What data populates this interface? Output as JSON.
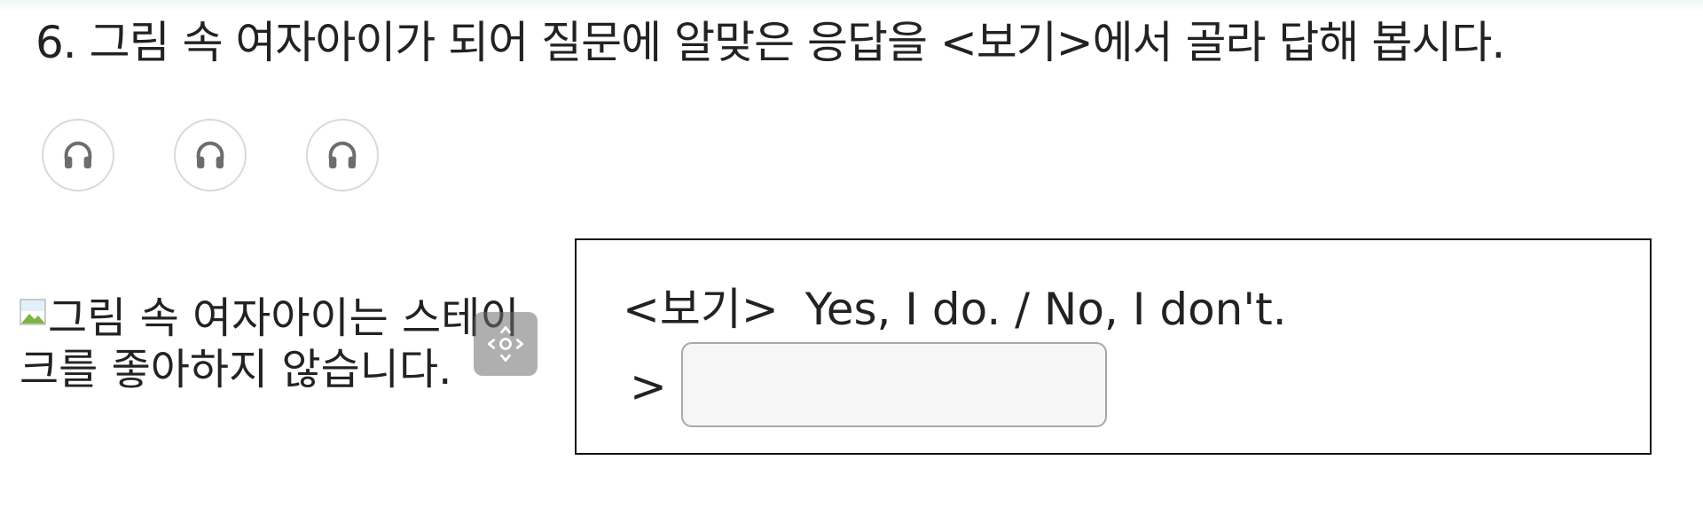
{
  "question": {
    "title": "6. 그림 속 여자아이가 되어 질문에 알맞은 응답을 <보기>에서 골라 답해 봅시다."
  },
  "audio_buttons": [
    {
      "icon": "headphones-icon"
    },
    {
      "icon": "headphones-icon"
    },
    {
      "icon": "headphones-icon"
    }
  ],
  "picture": {
    "alt_text": "그림 속 여자아이는 스테이크를 좋아하지 않습니다.",
    "icon": "broken-image-icon"
  },
  "move_handle": {
    "icon": "move-arrows-icon"
  },
  "bogi": {
    "label": "<보기>",
    "options_text": "Yes, I do. / No, I don't.",
    "answer_marker": ">",
    "answer_value": "",
    "answer_placeholder": ""
  },
  "colors": {
    "text": "#222222",
    "icon_gray": "#6d6d6d",
    "circle_border": "#d9d9d9",
    "input_bg": "#f6f6f6",
    "input_border": "#a8a8a8"
  }
}
